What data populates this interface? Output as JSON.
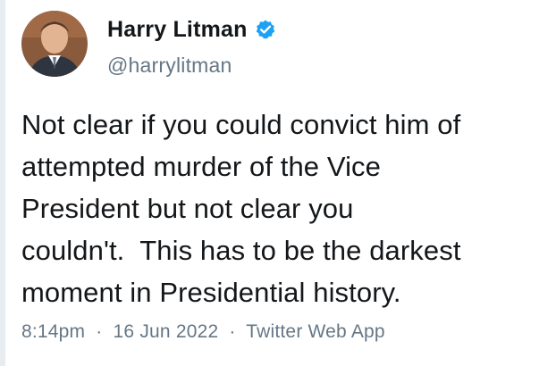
{
  "user": {
    "display_name": "Harry Litman",
    "handle": "@harrylitman",
    "verified_icon": "verified-badge-icon",
    "accent_color": "#1da1f2"
  },
  "tweet": {
    "text_lines": [
      "Not clear if you could convict him of",
      "attempted murder of the Vice",
      "President but not clear you",
      "couldn't.  This has to be the darkest",
      "moment in Presidential history."
    ],
    "time": "8:14pm",
    "date": "16 Jun 2022",
    "source": "Twitter Web App",
    "separator": "·"
  }
}
